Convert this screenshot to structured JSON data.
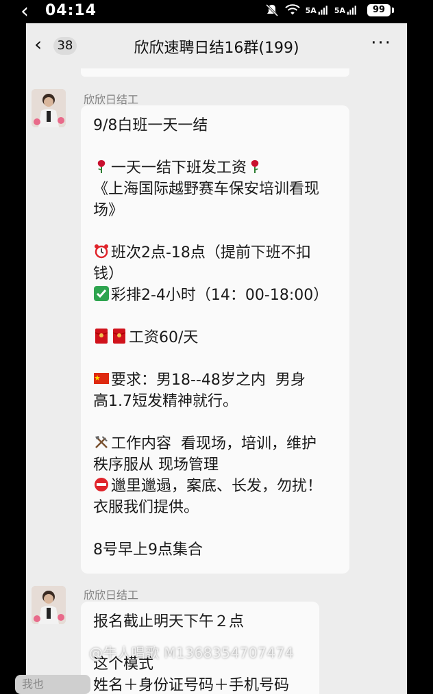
{
  "status_bar": {
    "time": "04:14",
    "network_left": "5A",
    "network_right": "5A",
    "battery": "99"
  },
  "chat": {
    "unread_count": "38",
    "title": "欣欣速聘日结16群(199)",
    "more": "···"
  },
  "messages": [
    {
      "sender": "欣欣日结工",
      "lines": [
        "9/8白班一天一结",
        "",
        "一天一结下班发工资",
        "《上海国际越野赛车保安培训看现",
        "场》",
        "",
        "班次2点-18点（提前下班不扣",
        "钱）",
        "彩排2-4小时（14：00-18:00）",
        "",
        "工资60/天",
        "",
        "要求：男18--48岁之内  男身",
        "高1.7短发精神就行。",
        "",
        "工作内容  看现场，培训，维护",
        "秩序服从 现场管理",
        "邋里邋遢，案底、长发，勿扰！",
        "衣服我们提供。",
        "",
        "8号早上9点集合"
      ]
    },
    {
      "sender": "欣欣日结工",
      "lines": [
        "报名截止明天下午２点",
        "",
        "这个模式",
        "姓名＋身份证号码＋手机号码"
      ]
    }
  ],
  "watermark": "@牛人唱歌 M1368354707474",
  "bottom_left": "我也",
  "colors": {
    "rose": "#c8102e",
    "check": "#2ea44f",
    "envelope": "#d0121b",
    "flag": "#de2910",
    "stop": "#e0242b"
  }
}
